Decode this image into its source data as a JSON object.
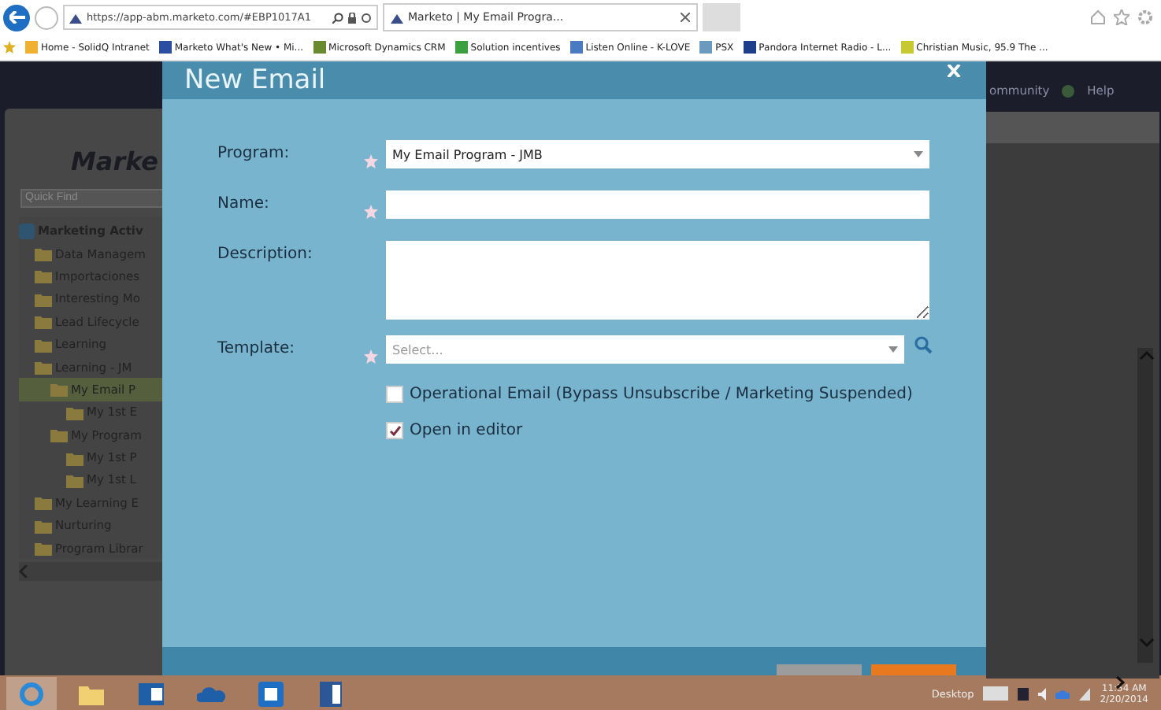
{
  "browser": {
    "address": "https://app-abm.marketo.com/#EBP1017A1",
    "tab": "Marketo | My Email Progra..."
  },
  "bookmarks": [
    "Home - SolidQ Intranet",
    "Marketo  What's New • Mi...",
    "Microsoft Dynamics CRM",
    "Solution incentives",
    "Listen Online - K-LOVE",
    "PSX",
    "Pandora Internet Radio - L...",
    "Christian Music, 95.9 The ..."
  ],
  "app": {
    "logo": "Marke",
    "quick_find": {
      "placeholder": "Quick Find"
    },
    "top_links": [
      "ommunity",
      "Help"
    ],
    "tree": [
      {
        "label": "Marketing Activ",
        "selected": false,
        "children": [
          {
            "label": "Data Managem",
            "selected": false
          },
          {
            "label": "Importaciones",
            "selected": false
          },
          {
            "label": "Interesting Mo",
            "selected": false
          },
          {
            "label": "Lead Lifecycle",
            "selected": false
          },
          {
            "label": "Learning",
            "selected": false
          },
          {
            "label": "Learning - JM",
            "selected": false,
            "children": [
              {
                "label": "My Email P",
                "selected": true,
                "children": [
                  {
                    "label": "My 1st E",
                    "selected": false
                  }
                ]
              },
              {
                "label": "My Program",
                "selected": false,
                "children": [
                  {
                    "label": "My 1st P",
                    "selected": false
                  },
                  {
                    "label": "My 1st L",
                    "selected": false
                  }
                ]
              }
            ]
          },
          {
            "label": "My Learning E",
            "selected": false
          },
          {
            "label": "Nurturing",
            "selected": false
          },
          {
            "label": "Program Librar",
            "selected": false
          }
        ]
      }
    ]
  },
  "dialog": {
    "title": "New Email",
    "fields": [
      {
        "label": "Program:",
        "kind": "select",
        "required": true,
        "value": "My Email Program - JMB"
      },
      {
        "label": "Name:",
        "kind": "text",
        "required": true
      },
      {
        "label": "Description:",
        "kind": "textarea",
        "required": false
      },
      {
        "label": "Template:",
        "kind": "lookup",
        "required": true,
        "placeholder": "Select..."
      }
    ],
    "options": [
      {
        "label": "Operational Email (Bypass Unsubscribe / Marketing Suspended)",
        "checked": false
      },
      {
        "label": "Open in editor",
        "checked": true
      }
    ]
  },
  "taskbar": {
    "desktop": "Desktop",
    "time": "11:54 AM",
    "date": "2/20/2014"
  }
}
